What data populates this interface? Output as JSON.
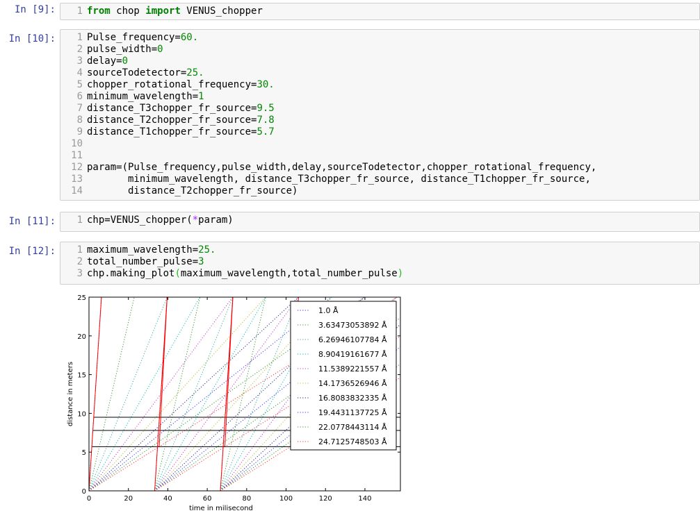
{
  "cells": [
    {
      "prompt": "In [9]:",
      "lines": [
        {
          "n": "1",
          "tokens": [
            {
              "t": "from",
              "c": "kw"
            },
            {
              "t": " chop "
            },
            {
              "t": "import",
              "c": "kw"
            },
            {
              "t": " VENUS_chopper"
            }
          ]
        }
      ]
    },
    {
      "prompt": "In [10]:",
      "lines": [
        {
          "n": "1",
          "tokens": [
            {
              "t": "Pulse_frequency="
            },
            {
              "t": "60.",
              "c": "num"
            }
          ]
        },
        {
          "n": "2",
          "tokens": [
            {
              "t": "pulse_width="
            },
            {
              "t": "0",
              "c": "num"
            }
          ]
        },
        {
          "n": "3",
          "tokens": [
            {
              "t": "delay="
            },
            {
              "t": "0",
              "c": "num"
            }
          ]
        },
        {
          "n": "4",
          "tokens": [
            {
              "t": "sourceTodetector="
            },
            {
              "t": "25.",
              "c": "num"
            }
          ]
        },
        {
          "n": "5",
          "tokens": [
            {
              "t": "chopper_rotational_frequency="
            },
            {
              "t": "30.",
              "c": "num"
            }
          ]
        },
        {
          "n": "6",
          "tokens": [
            {
              "t": "minimum_wavelength="
            },
            {
              "t": "1",
              "c": "num"
            }
          ]
        },
        {
          "n": "7",
          "tokens": [
            {
              "t": "distance_T3chopper_fr_source="
            },
            {
              "t": "9.5",
              "c": "num"
            }
          ]
        },
        {
          "n": "8",
          "tokens": [
            {
              "t": "distance_T2chopper_fr_source="
            },
            {
              "t": "7.8",
              "c": "num"
            }
          ]
        },
        {
          "n": "9",
          "tokens": [
            {
              "t": "distance_T1chopper_fr_source="
            },
            {
              "t": "5.7",
              "c": "num"
            }
          ]
        },
        {
          "n": "10",
          "tokens": []
        },
        {
          "n": "11",
          "tokens": []
        },
        {
          "n": "12",
          "tokens": [
            {
              "t": "param=(Pulse_frequency,pulse_width,delay,sourceTodetector,chopper_rotational_frequency,"
            }
          ]
        },
        {
          "n": "13",
          "tokens": [
            {
              "t": "       minimum_wavelength, distance_T3chopper_fr_source, distance_T1chopper_fr_source,"
            }
          ]
        },
        {
          "n": "14",
          "tokens": [
            {
              "t": "       distance_T2chopper_fr_source)"
            }
          ]
        }
      ]
    },
    {
      "prompt": "In [11]:",
      "lines": [
        {
          "n": "1",
          "tokens": [
            {
              "t": "chp=VENUS_chopper("
            },
            {
              "t": "*",
              "c": "op"
            },
            {
              "t": "param)"
            }
          ]
        }
      ]
    },
    {
      "prompt": "In [12]:",
      "lines": [
        {
          "n": "1",
          "tokens": [
            {
              "t": "maximum_wavelength="
            },
            {
              "t": "25.",
              "c": "num"
            }
          ]
        },
        {
          "n": "2",
          "tokens": [
            {
              "t": "total_number_pulse="
            },
            {
              "t": "3",
              "c": "num"
            }
          ]
        },
        {
          "n": "3",
          "tokens": [
            {
              "t": "chp.making_plot"
            },
            {
              "t": "(",
              "c": "paren"
            },
            {
              "t": "maximum_wavelength,total_number_pulse"
            },
            {
              "t": ")",
              "c": "paren"
            }
          ]
        }
      ]
    }
  ],
  "chart_data": {
    "type": "line",
    "xlabel": "time in milisecond",
    "ylabel": "distance in meters",
    "xlim": [
      0,
      158
    ],
    "ylim": [
      0,
      25
    ],
    "xticks": [
      0,
      20,
      40,
      60,
      80,
      100,
      120,
      140
    ],
    "yticks": [
      0,
      5,
      10,
      15,
      20,
      25
    ],
    "legend_position": "right-inside",
    "series": [
      {
        "name": "1.0 Å",
        "slope_ms_per_m": 0.2528,
        "color": "#3333cc"
      },
      {
        "name": "3.63473053892 Å",
        "slope_ms_per_m": 0.919,
        "color": "#339933"
      },
      {
        "name": "6.26946107784 Å",
        "slope_ms_per_m": 1.5852,
        "color": "#33aaaa"
      },
      {
        "name": "8.90419161677 Å",
        "slope_ms_per_m": 2.2514,
        "color": "#00bbbb"
      },
      {
        "name": "11.5389221557 Å",
        "slope_ms_per_m": 2.9176,
        "color": "#cc33cc"
      },
      {
        "name": "14.1736526946 Å",
        "slope_ms_per_m": 3.5838,
        "color": "#bbbb33"
      },
      {
        "name": "16.8083832335 Å",
        "slope_ms_per_m": 4.25,
        "color": "#222288"
      },
      {
        "name": "19.4431137725 Å",
        "slope_ms_per_m": 4.9162,
        "color": "#3333ff"
      },
      {
        "name": "22.0778443114 Å",
        "slope_ms_per_m": 5.5824,
        "color": "#339933"
      },
      {
        "name": "24.7125748503 Å",
        "slope_ms_per_m": 6.2486,
        "color": "#ff3333"
      }
    ],
    "pulse_period_ms": 33.33,
    "pulse_count": 3,
    "pulse_fast_slope_ms_per_m": 0.2528,
    "pulse_slow_slope_ms_per_m": 0.2528,
    "chopper_distances_m": [
      5.7,
      7.8,
      9.5
    ],
    "chopper_color": "#000000",
    "envelope_color": "#ff0000"
  }
}
